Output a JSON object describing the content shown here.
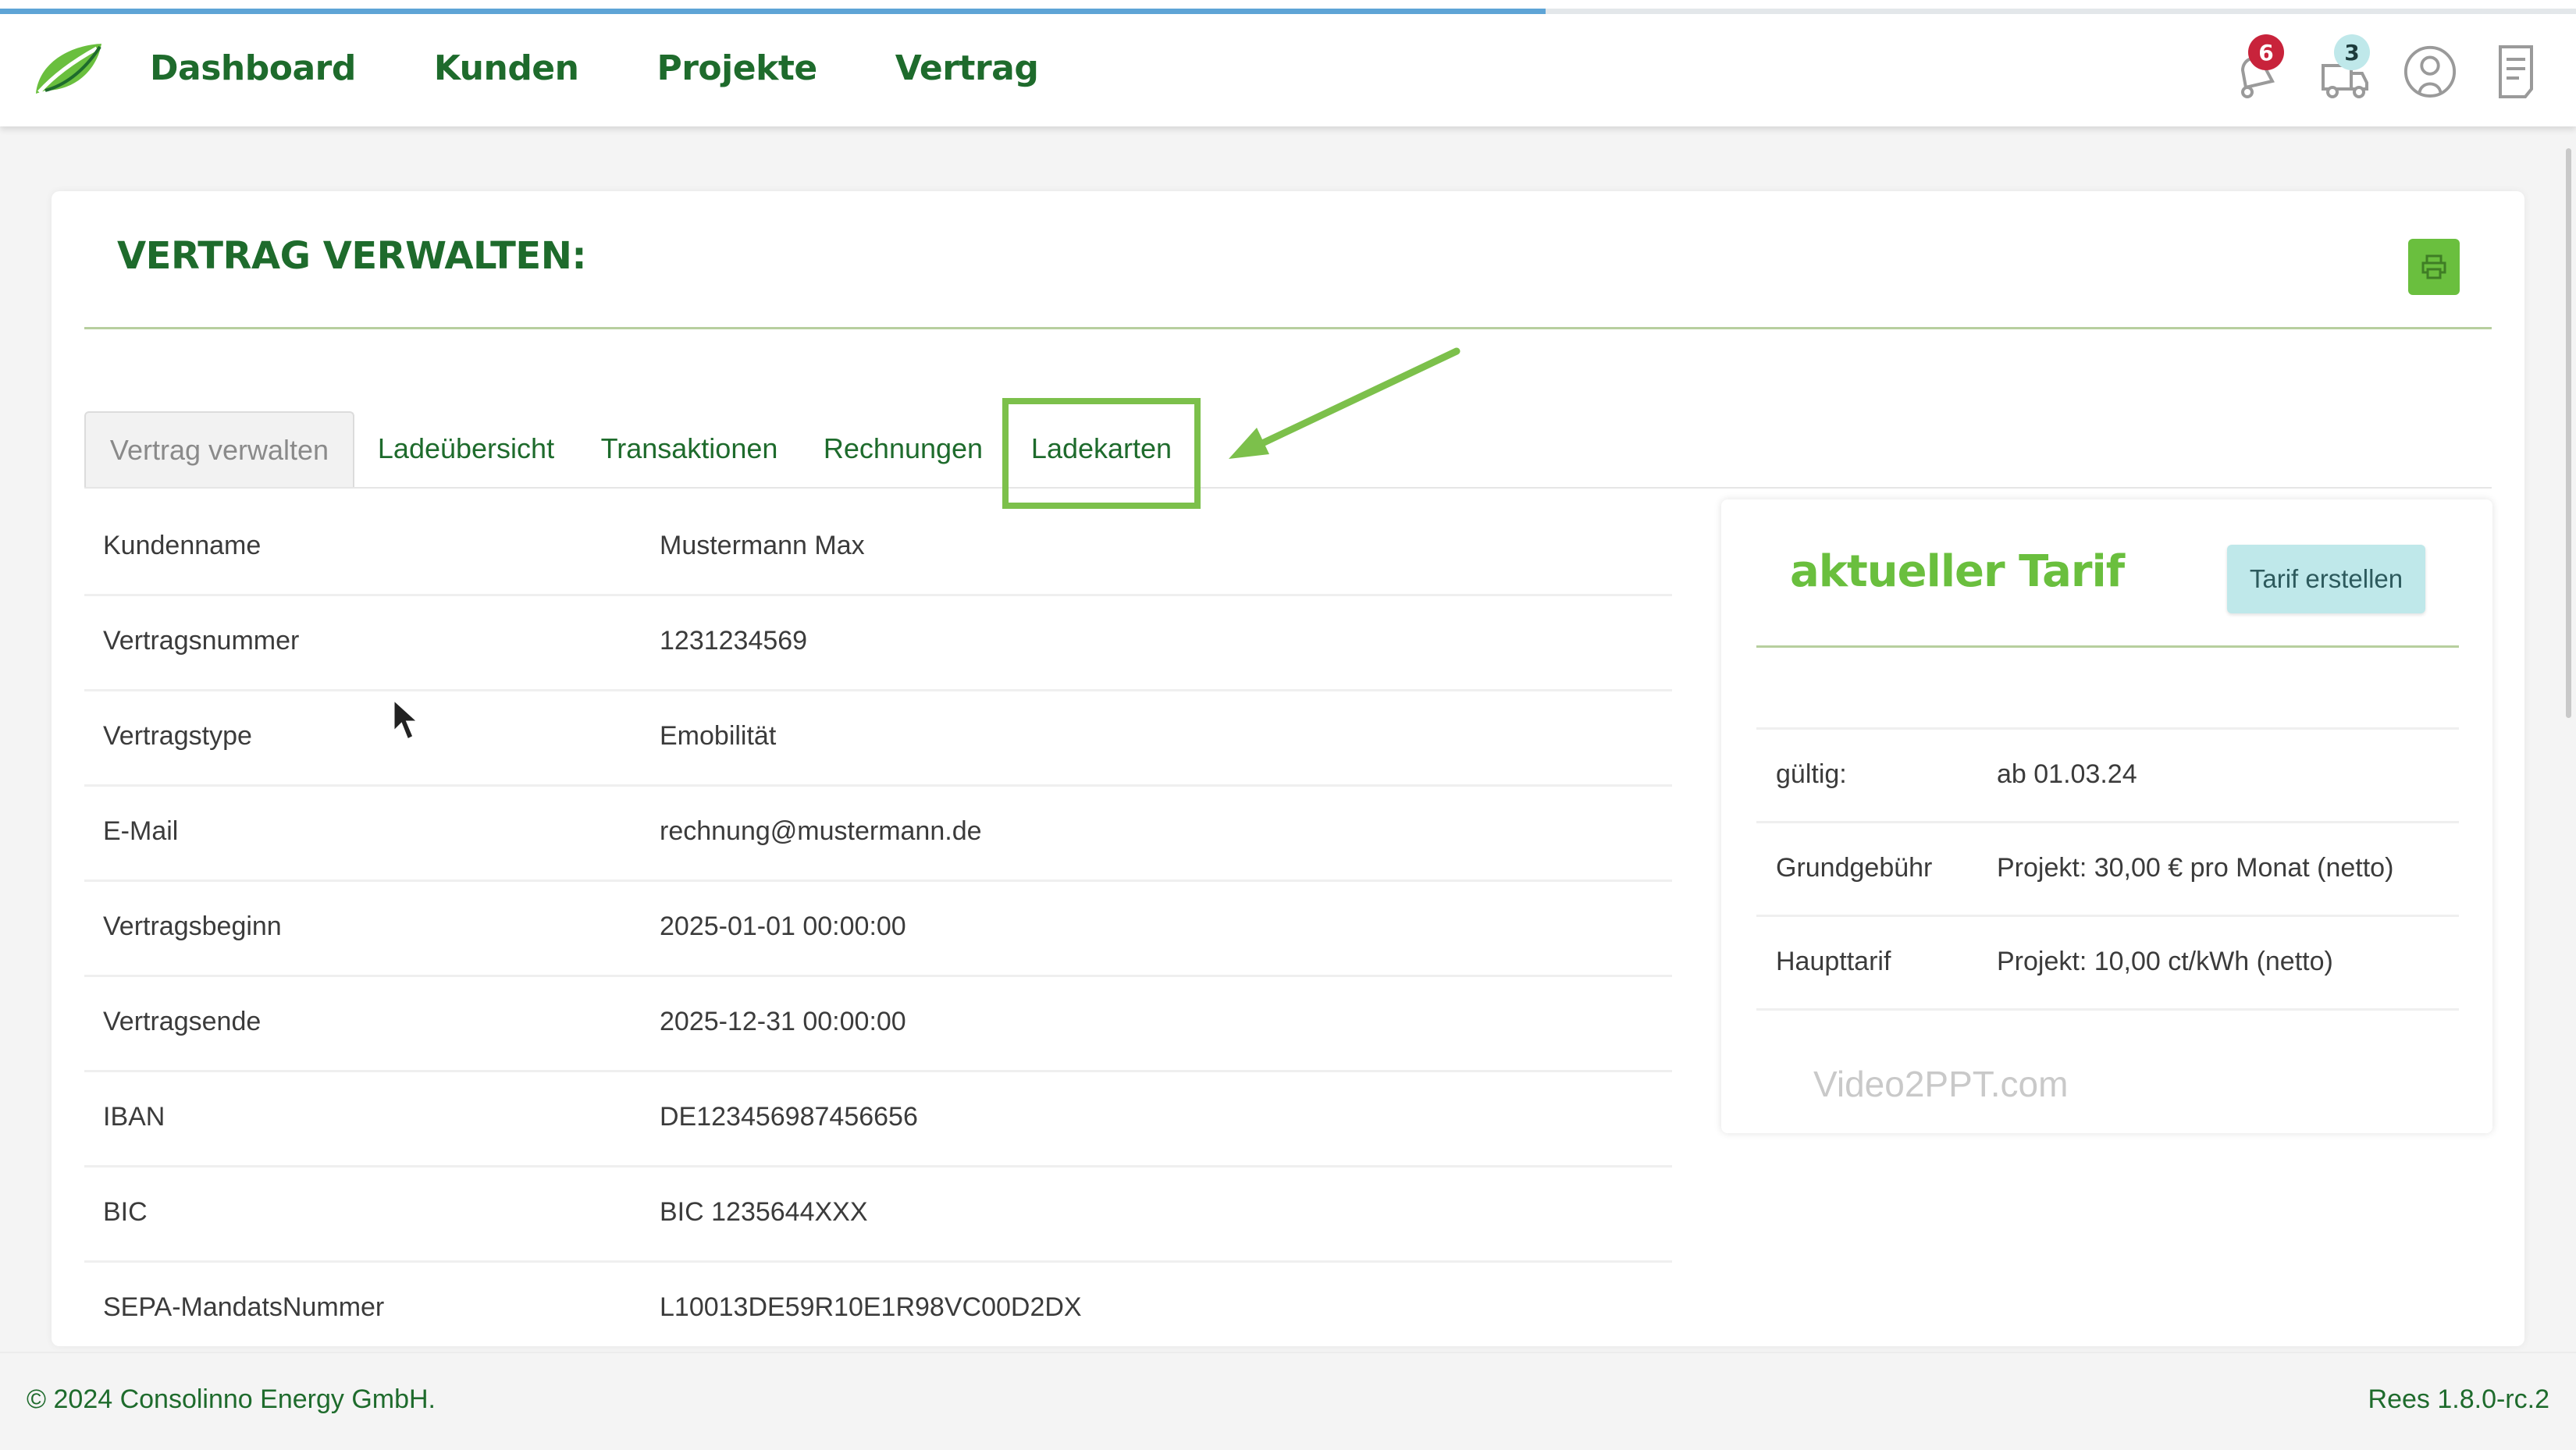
{
  "app": {
    "progress_fraction": 0.6,
    "accent_colors": {
      "brand_dark_green": "#1e6b2c",
      "brand_green": "#6abf3e",
      "highlight": "#7cc04b",
      "badge_red": "#c8233b",
      "badge_teal": "#bfe8ea"
    }
  },
  "nav": {
    "logo_icon": "leaf-logo-icon",
    "items": [
      {
        "label": "Dashboard"
      },
      {
        "label": "Kunden"
      },
      {
        "label": "Projekte"
      },
      {
        "label": "Vertrag"
      }
    ],
    "icons": [
      {
        "name": "notification-bell-icon",
        "badge": "6"
      },
      {
        "name": "delivery-truck-icon",
        "badge": "3"
      },
      {
        "name": "user-profile-icon"
      },
      {
        "name": "document-icon"
      }
    ]
  },
  "page": {
    "title": "VERTRAG VERWALTEN:",
    "print_icon": "print-icon"
  },
  "tabs": [
    {
      "label": "Vertrag verwalten",
      "active": true
    },
    {
      "label": "Ladeübersicht"
    },
    {
      "label": "Transaktionen"
    },
    {
      "label": "Rechnungen"
    },
    {
      "label": "Ladekarten",
      "highlighted": true
    }
  ],
  "contract": [
    {
      "key": "Kundenname",
      "value": "Mustermann Max"
    },
    {
      "key": "Vertragsnummer",
      "value": "1231234569"
    },
    {
      "key": "Vertragstype",
      "value": "Emobilität"
    },
    {
      "key": "E-Mail",
      "value": "rechnung@mustermann.de"
    },
    {
      "key": "Vertragsbeginn",
      "value": "2025-01-01 00:00:00"
    },
    {
      "key": "Vertragsende",
      "value": "2025-12-31 00:00:00"
    },
    {
      "key": "IBAN",
      "value": "DE123456987456656"
    },
    {
      "key": "BIC",
      "value": "BIC 1235644XXX"
    },
    {
      "key": "SEPA-MandatsNummer",
      "value": "L10013DE59R10E1R98VC00D2DX"
    }
  ],
  "tariff": {
    "title": "aktueller Tarif",
    "button_label": "Tarif erstellen",
    "rows": [
      {
        "key": "gültig:",
        "value": "ab 01.03.24"
      },
      {
        "key": "Grundgebühr",
        "value": "Projekt: 30,00 € pro Monat (netto)"
      },
      {
        "key": "Haupttarif",
        "value": "Projekt: 10,00 ct/kWh (netto)"
      }
    ],
    "watermark": "Video2PPT.com"
  },
  "footer": {
    "copyright": "© 2024 Consolinno Energy GmbH.",
    "version": "Rees 1.8.0-rc.2"
  }
}
